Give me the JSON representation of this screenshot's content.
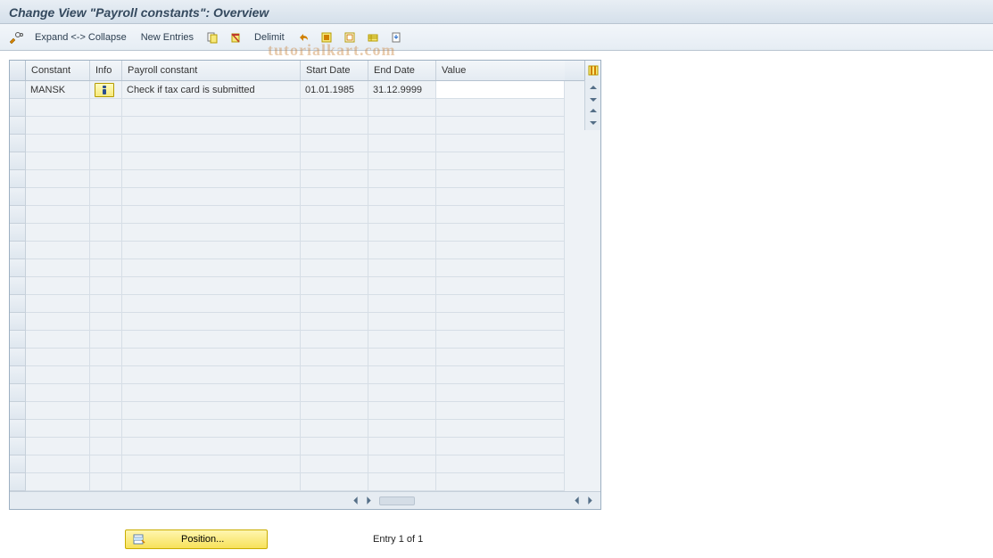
{
  "header": {
    "title": "Change View \"Payroll constants\": Overview"
  },
  "toolbar": {
    "expand_collapse": "Expand <-> Collapse",
    "new_entries": "New Entries",
    "delimit": "Delimit"
  },
  "grid": {
    "columns": {
      "constant": "Constant",
      "info": "Info",
      "payroll_constant": "Payroll constant",
      "start_date": "Start Date",
      "end_date": "End Date",
      "value": "Value"
    },
    "rows": [
      {
        "constant": "MANSK",
        "info_icon": "info",
        "payroll_constant": "Check if tax card is submitted",
        "start_date": "01.01.1985",
        "end_date": "31.12.9999",
        "value": ""
      }
    ],
    "empty_rows": 22
  },
  "footer": {
    "position_label": "Position...",
    "entry_status": "Entry 1 of 1"
  },
  "watermark": "tutorialkart.com"
}
